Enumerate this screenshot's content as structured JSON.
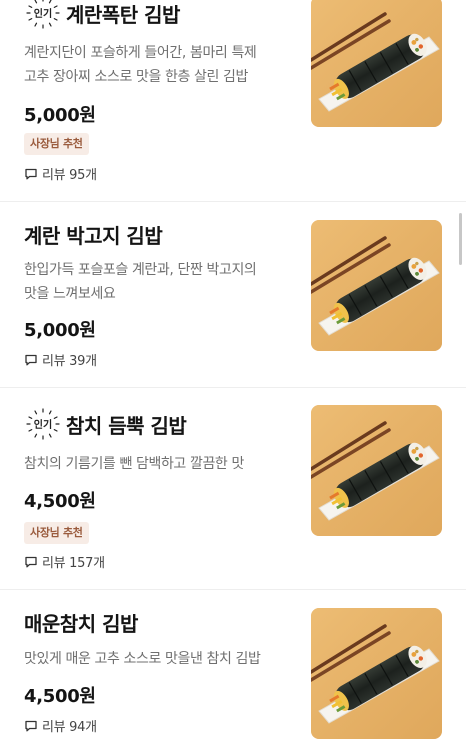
{
  "menu_items": [
    {
      "badge": "인기",
      "name": "계란폭탄 김밥",
      "desc_line1": "계란지단이 포슬하게 들어간, 봄마리 특제",
      "desc_line2": "고추 장아찌 소스로 맛을 한층 살린 김밥",
      "price": "5,000원",
      "owner_tag": "사장님 추천",
      "reviews": "리뷰 95개",
      "image": "gimbap-photo"
    },
    {
      "badge": "",
      "name": "계란 박고지 김밥",
      "desc_line1": "한입가득 포슬포슬 계란과, 단짠 박고지의",
      "desc_line2": "맛을 느껴보세요",
      "price": "5,000원",
      "owner_tag": "",
      "reviews": "리뷰 39개",
      "image": "gimbap-photo"
    },
    {
      "badge": "인기",
      "name": "참치 듬뿍 김밥",
      "desc_line1": "참치의 기름기를 뺀 담백하고 깔끔한 맛",
      "desc_line2": "",
      "price": "4,500원",
      "owner_tag": "사장님 추천",
      "reviews": "리뷰 157개",
      "image": "gimbap-photo"
    },
    {
      "badge": "",
      "name": "매운참치 김밥",
      "desc_line1": "맛있게 매운 고추 소스로 맛을낸 참치 김밥",
      "desc_line2": "",
      "price": "4,500원",
      "owner_tag": "",
      "reviews": "리뷰 94개",
      "image": "gimbap-photo"
    }
  ],
  "colors": {
    "owner_tag_bg": "#f7ece6",
    "owner_tag_text": "#9a5b3d",
    "description": "#6f6f6f",
    "photo_bg": "#e8b56a"
  },
  "icons": {
    "review": "speech-bubble-icon",
    "popular": "popular-badge-icon"
  }
}
